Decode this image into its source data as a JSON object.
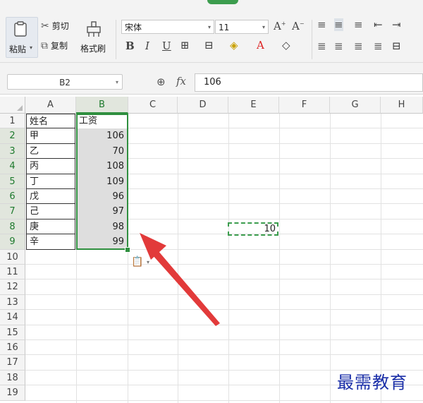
{
  "ribbon": {
    "paste_label": "粘贴",
    "cut_label": "剪切",
    "copy_label": "复制",
    "format_painter_label": "格式刷",
    "font_name": "宋体",
    "font_size": "11",
    "bold": "B",
    "italic": "I",
    "underline": "U"
  },
  "formula_bar": {
    "name_box": "B2",
    "fx_label": "fx",
    "value": "106"
  },
  "sheet": {
    "columns": [
      "A",
      "B",
      "C",
      "D",
      "E",
      "F",
      "G",
      "H"
    ],
    "rows": [
      "1",
      "2",
      "3",
      "4",
      "5",
      "6",
      "7",
      "8",
      "9",
      "10",
      "11",
      "12",
      "13",
      "14",
      "15",
      "16",
      "17",
      "18",
      "19"
    ],
    "header_row": {
      "a": "姓名",
      "b": "工资"
    },
    "data": [
      {
        "name": "甲",
        "salary": "106"
      },
      {
        "name": "乙",
        "salary": "70"
      },
      {
        "name": "丙",
        "salary": "108"
      },
      {
        "name": "丁",
        "salary": "109"
      },
      {
        "name": "戊",
        "salary": "96"
      },
      {
        "name": "己",
        "salary": "97"
      },
      {
        "name": "庚",
        "salary": "98"
      },
      {
        "name": "辛",
        "salary": "99"
      }
    ],
    "copied_cell_value": "10",
    "selected_column": "B",
    "selected_rows": [
      "2",
      "3",
      "4",
      "5",
      "6",
      "7",
      "8",
      "9"
    ]
  },
  "colors": {
    "accent_green": "#2f8f3f",
    "arrow_red": "#e23a3a",
    "watermark_blue": "#1b2fa8"
  },
  "watermark": "最需教育"
}
